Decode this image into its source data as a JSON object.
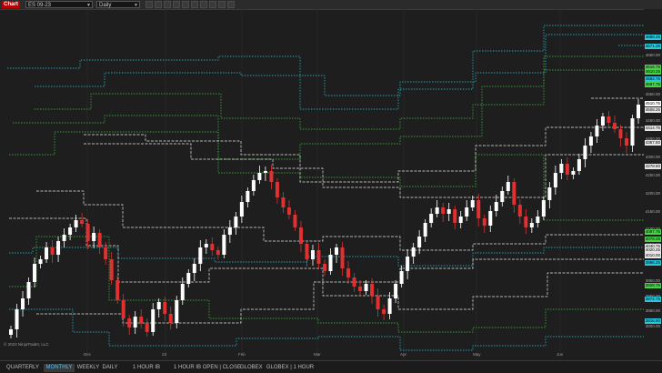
{
  "toolbar": {
    "app_tab": "Chart",
    "symbol": "ES 09-23",
    "interval": "Daily",
    "icons": [
      "drawing-icon",
      "gear-icon",
      "crosshair-icon",
      "zoom-icon",
      "layout-icon",
      "dom-icon",
      "order-icon",
      "template-icon",
      "share-icon",
      "tools-icon"
    ]
  },
  "chart": {
    "copyright": "© 2023 NinjaTrader, LLC",
    "date_labels": [
      "Dec",
      "23",
      "Feb",
      "Mar",
      "Apr",
      "May",
      "Jun"
    ],
    "price_labels": [
      {
        "text": "4688.25",
        "style": "cyan"
      },
      {
        "text": "4671.25",
        "style": "cyan"
      },
      {
        "text": "4650.00",
        "style": "plain"
      },
      {
        "text": "4616.75",
        "style": "green"
      },
      {
        "text": "4610.25",
        "style": "green"
      },
      {
        "text": "4592.75",
        "style": "cyan"
      },
      {
        "text": "4587.75",
        "style": "green"
      },
      {
        "text": "4550.00",
        "style": "plain"
      },
      {
        "text": "4510.75",
        "style": "lastprice"
      },
      {
        "text": "4508.25",
        "style": "white"
      },
      {
        "text": "4450.00",
        "style": "plain"
      },
      {
        "text": "4414.75",
        "style": "white"
      },
      {
        "text": "4400.00",
        "style": "plain"
      },
      {
        "text": "4357.50",
        "style": "white"
      },
      {
        "text": "4300.00",
        "style": "plain"
      },
      {
        "text": "4278.50",
        "style": "white"
      },
      {
        "text": "4250.00",
        "style": "plain"
      },
      {
        "text": "4200.00",
        "style": "plain"
      },
      {
        "text": "4150.00",
        "style": "plain"
      },
      {
        "text": "4100.00",
        "style": "plain"
      },
      {
        "text": "4097.75",
        "style": "green"
      },
      {
        "text": "4078.25",
        "style": "green"
      },
      {
        "text": "4050.00",
        "style": "plain"
      },
      {
        "text": "4040.75",
        "style": "white"
      },
      {
        "text": "4020.25",
        "style": "white"
      },
      {
        "text": "4010.00",
        "style": "white"
      },
      {
        "text": "3996.25",
        "style": "cyan"
      },
      {
        "text": "3950.00",
        "style": "plain"
      },
      {
        "text": "3928.75",
        "style": "green"
      },
      {
        "text": "3900.00",
        "style": "plain"
      },
      {
        "text": "3872.75",
        "style": "cyan"
      },
      {
        "text": "3850.00",
        "style": "plain"
      },
      {
        "text": "3816.50",
        "style": "cyan"
      },
      {
        "text": "3800.00",
        "style": "plain"
      }
    ]
  },
  "bottom_tabs": [
    {
      "label": "QUARTERLY",
      "active": false
    },
    {
      "label": "MONTHLY",
      "active": true
    },
    {
      "label": "WEEKLY",
      "active": false
    },
    {
      "label": "DAILY",
      "active": false
    },
    {
      "label": "1 HOUR IB OPEN",
      "active": false
    },
    {
      "label": "1 HOUR IB OPEN | CLOSE",
      "active": false
    },
    {
      "label": "GLOBEX",
      "active": false
    },
    {
      "label": "GLOBEX | 1 HOUR IB",
      "active": false
    }
  ],
  "colors": {
    "background": "#1e1e1e",
    "bull": "#ffffff",
    "bear": "#e03030",
    "cyan": "#2bc6dc",
    "green": "#3ec43e",
    "white_level": "#e6e6e6",
    "accent_tab": "#49c4ff",
    "app_tab": "#b40000"
  }
}
